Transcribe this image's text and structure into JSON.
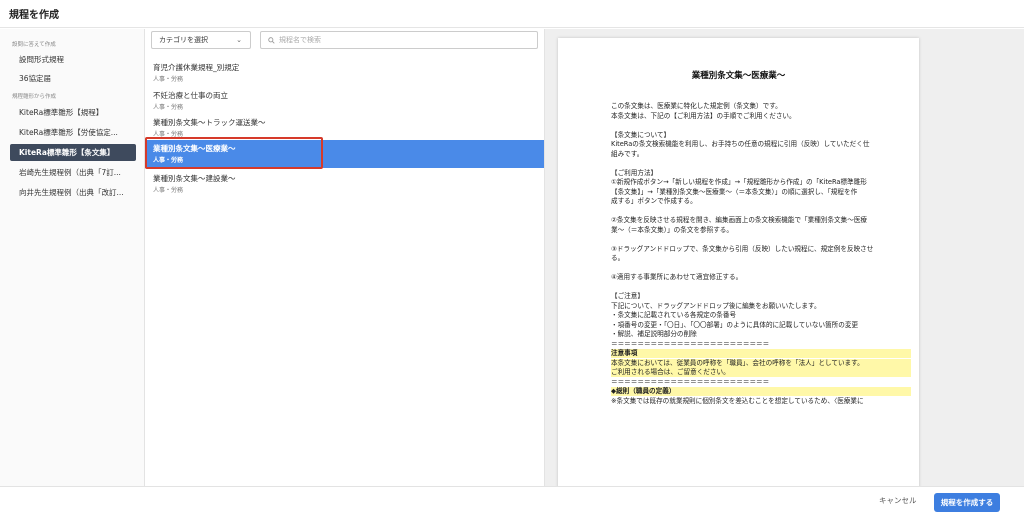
{
  "header": {
    "title": "規程を作成"
  },
  "sidebar": {
    "sections": [
      {
        "label": "設問に答えて作成"
      },
      {
        "label": "規程雛形から作成"
      }
    ],
    "items": [
      {
        "label": "設問形式規程"
      },
      {
        "label": "36協定届"
      },
      {
        "label": "KiteRa標準雛形【規程】"
      },
      {
        "label": "KiteRa標準雛形【労使協定..."
      },
      {
        "label": "KiteRa標準雛形【条文集】"
      },
      {
        "label": "岩崎先生規程例（出典「7訂..."
      },
      {
        "label": "向井先生規程例（出典「改訂..."
      }
    ],
    "active_index": 4
  },
  "filters": {
    "category_label": "カテゴリを選択",
    "search_placeholder": "規程名で検索"
  },
  "list": {
    "items": [
      {
        "title": "育児介護休業規程_別規定",
        "category": "人事・労務"
      },
      {
        "title": "不妊治療と仕事の両立",
        "category": "人事・労務"
      },
      {
        "title": "業種別条文集〜トラック運送業〜",
        "category": "人事・労務"
      },
      {
        "title": "業種別条文集〜医療業〜",
        "category": "人事・労務"
      },
      {
        "title": "業種別条文集〜建設業〜",
        "category": "人事・労務"
      }
    ],
    "selected_index": 3
  },
  "preview": {
    "title": "業種別条文集〜医療業〜",
    "lines": [
      "この条文集は、医療業に特化した規定例（条文集）です。",
      "本条文集は、下記の【ご利用方法】の手順でご利用ください。",
      "",
      "【条文集について】",
      "KiteRaの条文検索機能を利用し、お手持ちの任意の規程に引用（反映）していただく仕",
      "組みです。",
      "",
      "【ご利用方法】",
      "①新規作成ボタン→「新しい規程を作成」→「規程雛形から作成」の「KiteRa標準雛形",
      "【条文集】」→「業種別条文集〜医療業〜（＝本条文集）」の順に選択し、「規程を作",
      "成する」ボタンで作成する。",
      "",
      "②条文集を反映させる規程を開き、編集画面上の条文検索機能で「業種別条文集〜医療",
      "業〜（＝本条文集）」の条文を参照する。",
      "",
      "③ドラッグアンドドロップで、条文集から引用（反映）したい規程に、規定例を反映させ",
      "る。",
      "",
      "④適用する事業所にあわせて適宜修正する。",
      "",
      "【ご注意】",
      "下記について、ドラッグアンドドロップ後に編集をお願いいたします。",
      "・条文集に記載されている各規定の条番号",
      "・項番号の変更・「〇日」、「〇〇部署」のように具体的に記載していない箇所の変更",
      "・解説、補足説明部分の削除",
      "＝＝＝＝＝＝＝＝＝＝＝＝＝＝＝＝＝＝＝＝＝＝＝＝",
      "注意事項",
      "本条文集においては、従業員の呼称を「職員」、会社の呼称を「法人」としています。",
      "ご利用される場合は、ご留意ください。",
      "＝＝＝＝＝＝＝＝＝＝＝＝＝＝＝＝＝＝＝＝＝＝＝＝",
      "◆総則（職員の定義）",
      "※条文集では既存の就業規則に個別条文を差込むことを想定しているため、〈医療業に"
    ]
  },
  "footer": {
    "cancel_label": "キャンセル",
    "create_label": "規程を作成する"
  }
}
